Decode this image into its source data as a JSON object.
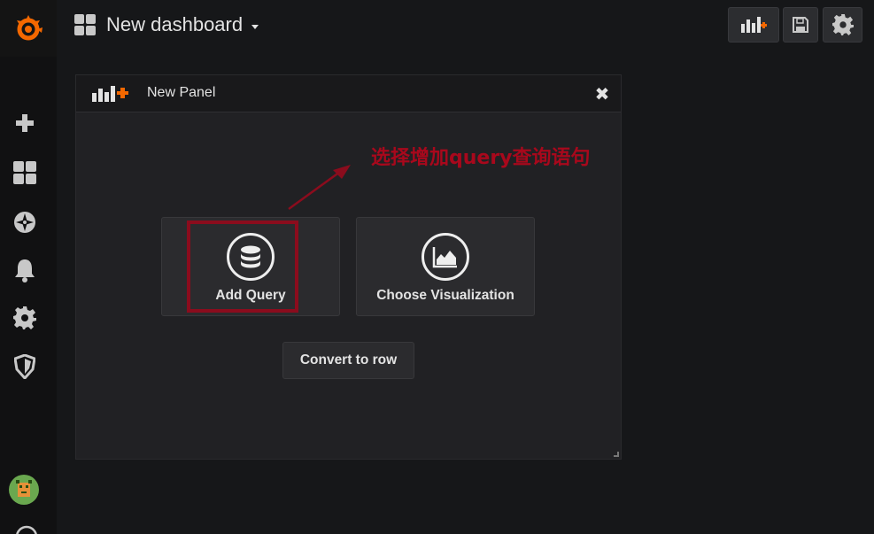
{
  "dashboard": {
    "title": "New dashboard"
  },
  "panel": {
    "title": "New Panel",
    "close_symbol": "✖",
    "actions": [
      {
        "label": "Add Query",
        "icon": "database-icon"
      },
      {
        "label": "Choose Visualization",
        "icon": "area-chart-icon"
      }
    ],
    "convert_label": "Convert to row"
  },
  "annotation": {
    "text": "选择增加query查询语句",
    "color": "#a8081c"
  },
  "colors": {
    "accent": "#f46800",
    "background": "#161719",
    "sidebar": "#111112",
    "panel": "#212124"
  },
  "sidebar": {
    "items": [
      {
        "icon": "plus-icon"
      },
      {
        "icon": "dashboards-icon"
      },
      {
        "icon": "compass-icon"
      },
      {
        "icon": "bell-icon"
      },
      {
        "icon": "gear-icon"
      },
      {
        "icon": "shield-icon"
      }
    ]
  },
  "toolbar": {
    "buttons": [
      "add-panel-icon",
      "save-icon",
      "settings-icon"
    ]
  }
}
